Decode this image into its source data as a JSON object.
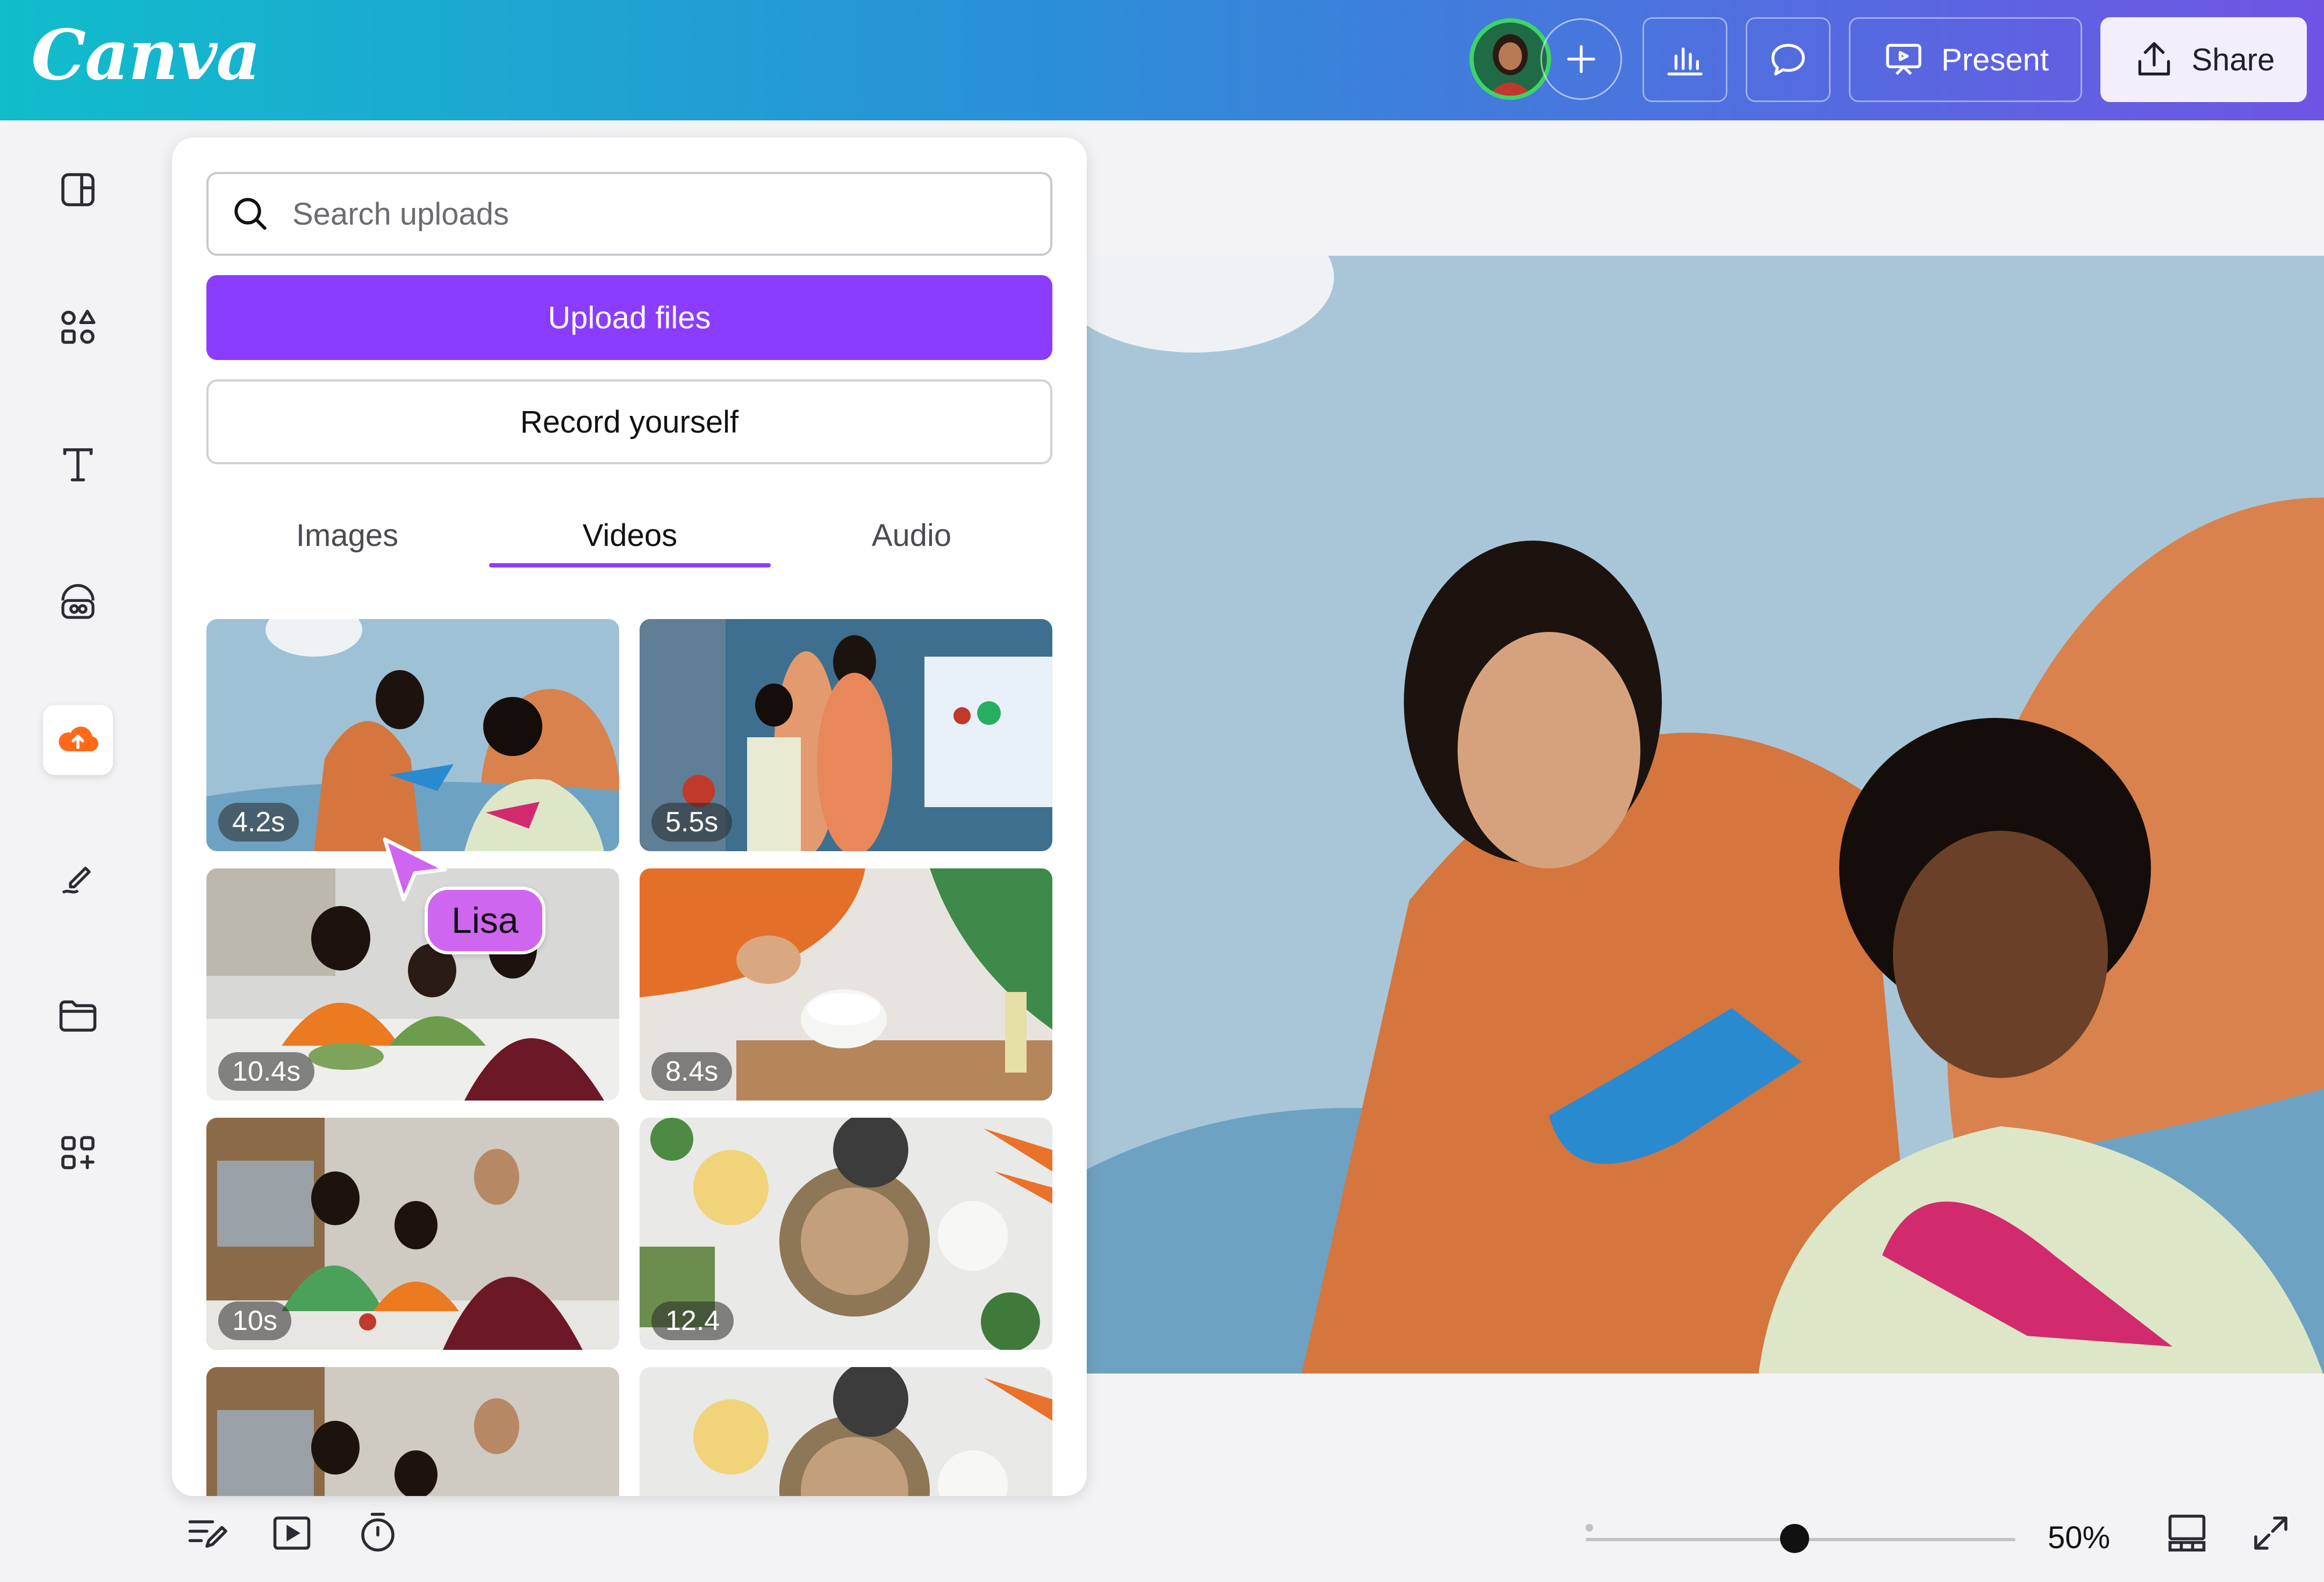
{
  "header": {
    "logo": "Canva",
    "present_label": "Present",
    "share_label": "Share"
  },
  "icons": {
    "add_collaborator": "plus-icon",
    "insights": "bar-chart-icon",
    "comments": "speech-bubble-icon",
    "present": "presentation-screen-icon",
    "share": "upload-arrow-icon"
  },
  "sidebar": {
    "items": [
      {
        "icon": "layout-icon"
      },
      {
        "icon": "elements-icon"
      },
      {
        "icon": "text-icon"
      },
      {
        "icon": "brand-icon"
      },
      {
        "icon": "uploads-icon",
        "active": true
      },
      {
        "icon": "draw-icon"
      },
      {
        "icon": "folder-icon"
      },
      {
        "icon": "apps-icon"
      }
    ]
  },
  "uploads_panel": {
    "search_placeholder": "Search uploads",
    "upload_button": "Upload files",
    "record_button": "Record yourself",
    "tabs": [
      {
        "label": "Images",
        "active": false
      },
      {
        "label": "Videos",
        "active": true
      },
      {
        "label": "Audio",
        "active": false
      }
    ],
    "videos": [
      {
        "duration": "4.2s"
      },
      {
        "duration": "5.5s"
      },
      {
        "duration": "10.4s"
      },
      {
        "duration": "8.4s"
      },
      {
        "duration": "10s"
      },
      {
        "duration": "12.4"
      },
      {
        "duration": ""
      },
      {
        "duration": ""
      }
    ]
  },
  "collaborator_cursor": {
    "name": "Lisa",
    "color": "#cf66f0"
  },
  "footer": {
    "zoom": "50%",
    "zoom_level_fraction": 0.45
  },
  "colors": {
    "accent": "#8b3dff",
    "header_gradient_start": "#10bdcb",
    "header_gradient_end": "#6f54e4",
    "uploads_active_icon": "#ff6a1a"
  }
}
